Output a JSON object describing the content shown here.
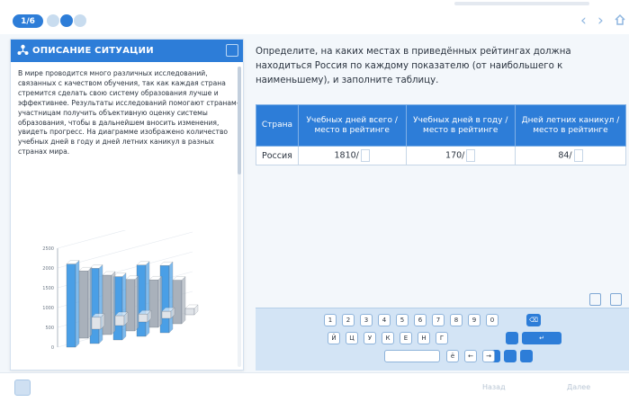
{
  "topbar": {
    "task_pill": "1/6",
    "prev_icon": "chevron-left-icon",
    "next_icon": "chevron-right-icon",
    "home_icon": "home-icon",
    "prev_glyph": "‹",
    "next_glyph": "›"
  },
  "left_panel": {
    "title": "ОПИСАНИЕ СИТУАЦИИ",
    "text": "В мире проводится много различных исследований, связанных с качеством обучения, так как каждая страна стремится сделать свою систему образования лучше и эффективнее. Результаты исследований помогают странам-участницам получить объективную оценку системы образования, чтобы в дальнейшем вносить изменения, увидеть прогресс. На диаграмме изображено количество учебных дней в году и дней летних каникул в разных странах мира."
  },
  "question": {
    "text": "Определите, на каких местах в приведённых рейтингах должна находиться Россия по каждому показателю (от наибольшего к наименьшему), и заполните таблицу."
  },
  "table": {
    "headers": [
      "Страна",
      "Учебных дней всего / место в рейтинге",
      "Учебных дней в году / место в рейтинге",
      "Дней летних каникул / место в рейтинге"
    ],
    "rows": [
      {
        "country": "Россия",
        "total_days": "1810/",
        "days_per_year": "170/",
        "summer_days": "84/"
      }
    ]
  },
  "keyboard": {
    "row1": [
      "1",
      "2",
      "3",
      "4",
      "5",
      "6",
      "7",
      "8",
      "9",
      "0"
    ],
    "row2": [
      "Й",
      "Ц",
      "У",
      "К",
      "Е",
      "Н",
      "Г"
    ],
    "row3": [
      "ё",
      "←",
      "→"
    ],
    "enter_label": "↵",
    "backspace_label": "⌫"
  },
  "bottom_bar": {
    "prev_label": "Назад",
    "next_label": "Далее"
  },
  "chart_data": {
    "type": "bar",
    "title": "",
    "xlabel": "",
    "ylabel": "",
    "series": [
      {
        "color": "#4a9fe6",
        "values": [
          2100,
          1900,
          1600,
          1800,
          1700
        ]
      },
      {
        "color": "#a9b1bb",
        "values": [
          1700,
          1500,
          1300,
          1200,
          1100
        ]
      },
      {
        "color": "#dfe3e8",
        "values": [
          300,
          250,
          200,
          180,
          160
        ]
      }
    ],
    "ylim": [
      0,
      2500
    ],
    "legend": "right"
  },
  "colors": {
    "accent": "#2d7dd8",
    "panel_bg": "#ffffff",
    "keyboard_bg": "#d3e4f5"
  }
}
